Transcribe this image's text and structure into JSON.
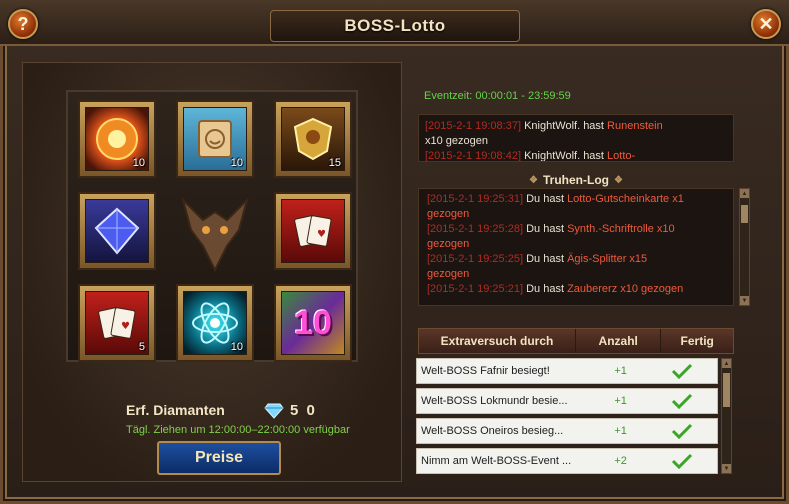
{
  "window": {
    "title": "BOSS-Lotto"
  },
  "icons": {
    "help": "?",
    "close": "✕"
  },
  "grid": [
    {
      "icon": "fire-orb-icon",
      "qty": "10"
    },
    {
      "icon": "scroll-icon",
      "qty": "10"
    },
    {
      "icon": "shield-shard-icon",
      "qty": "15"
    },
    {
      "icon": "blue-gem-icon",
      "qty": ""
    },
    {
      "icon": "playing-cards-icon",
      "qty": ""
    },
    {
      "icon": "playing-cards-icon",
      "qty": "5"
    },
    {
      "icon": "energy-orb-icon",
      "qty": "10"
    },
    {
      "icon": "gem-pack-icon",
      "qty": "",
      "overlay": "10"
    }
  ],
  "cost": {
    "label": "Erf. Diamanten",
    "value": "5 0"
  },
  "daily_note": "Tägl. Ziehen um 12:00:00–22:00:00 verfügbar",
  "prizes_button": "Preise",
  "event_time": "Eventzeit: 00:00:01 - 23:59:59",
  "global_log": [
    {
      "ts": "[2015-2-1 19:08:37]",
      "who": " KnightWolf. hast ",
      "item": "Runenstein",
      "tail": "x10 gezogen"
    },
    {
      "ts": "[2015-2-1 19:08:42]",
      "who": " KnightWolf. hast ",
      "item": "Lotto-",
      "tail": ""
    }
  ],
  "chest_log_title": "Truhen-Log",
  "chest_log": [
    {
      "ts": "[2015-2-1 19:25:31]",
      "who": " Du hast ",
      "item": "Lotto-Gutscheinkarte x1",
      "tail": "gezogen"
    },
    {
      "ts": "[2015-2-1 19:25:28]",
      "who": " Du hast ",
      "item": "Synth.-Schriftrolle x10",
      "tail": "gezogen"
    },
    {
      "ts": "[2015-2-1 19:25:25]",
      "who": " Du hast ",
      "item": "Ägis-Splitter x15",
      "tail": "gezogen"
    },
    {
      "ts": "[2015-2-1 19:25:21]",
      "who": " Du hast ",
      "item": "Zaubererz x10 gezogen",
      "tail": ""
    }
  ],
  "tasks": {
    "headers": [
      "Extraversuch durch",
      "Anzahl",
      "Fertig"
    ],
    "rows": [
      {
        "name": "Welt-BOSS Fafnir besiegt!",
        "count": "+1",
        "done": true
      },
      {
        "name": "Welt-BOSS Lokmundr besie...",
        "count": "+1",
        "done": true
      },
      {
        "name": "Welt-BOSS Oneiros besieg...",
        "count": "+1",
        "done": true
      },
      {
        "name": "Nimm am Welt-BOSS-Event ...",
        "count": "+2",
        "done": true
      }
    ]
  },
  "colors": {
    "accent_green": "#66d24a",
    "timestamp_red": "#b32b22",
    "item_orange": "#ef5a3c"
  }
}
